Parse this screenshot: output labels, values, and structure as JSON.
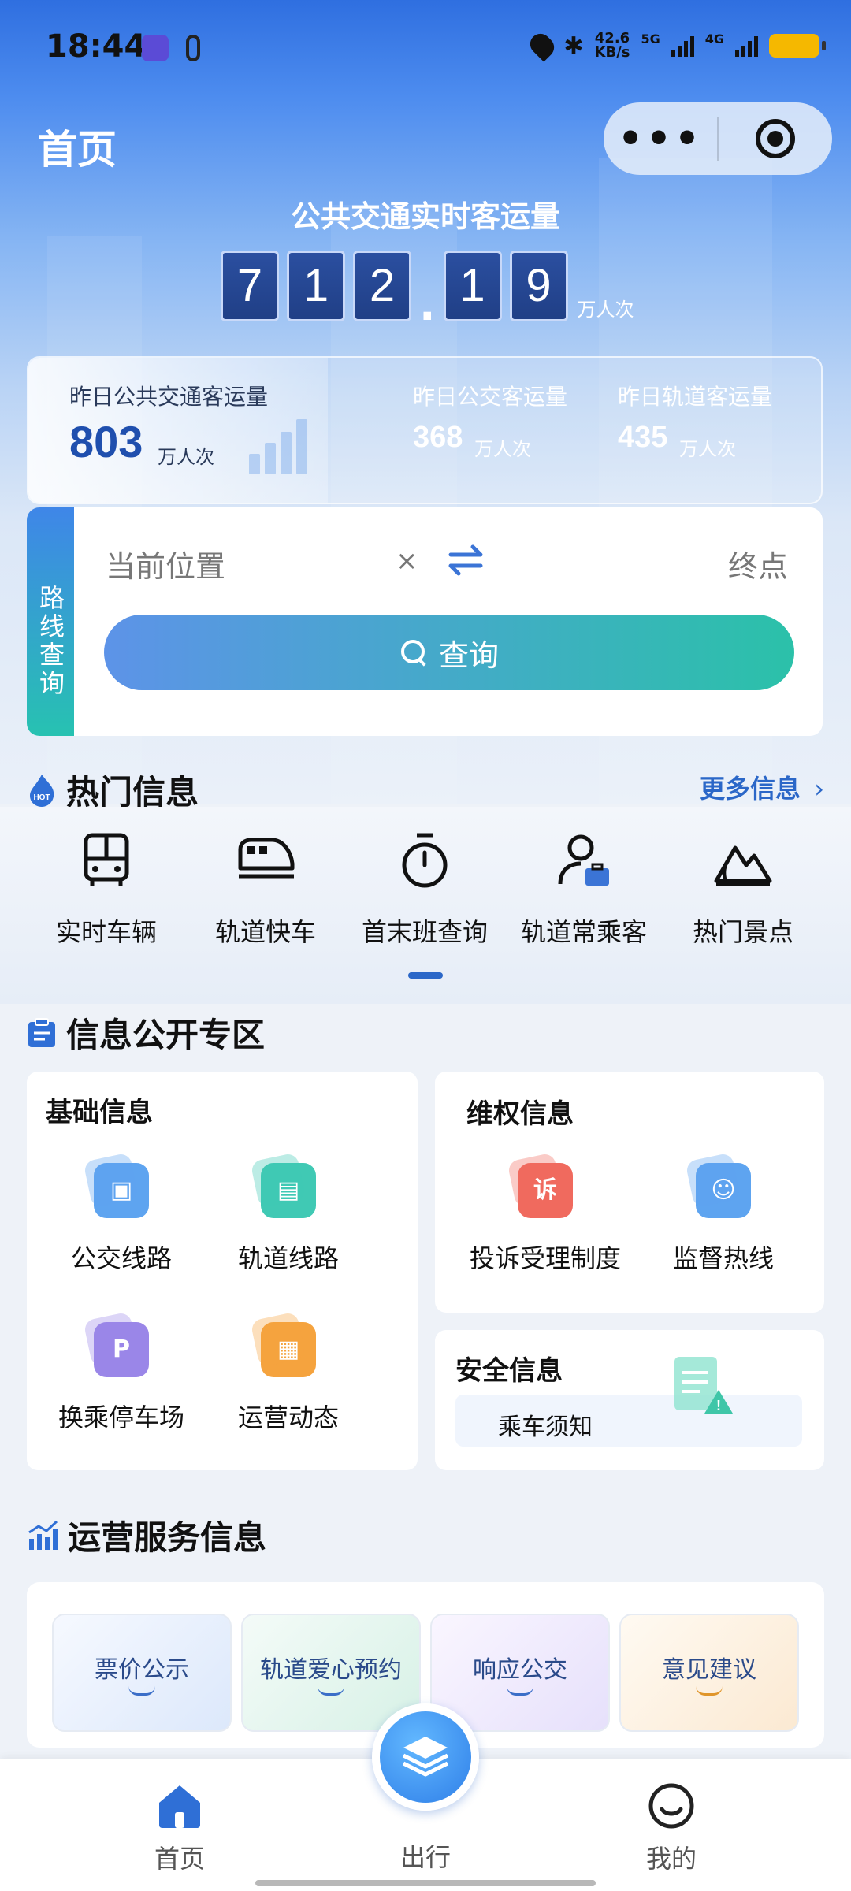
{
  "status_bar": {
    "time": "18:44",
    "net_speed": "42.6",
    "net_unit": "KB/s",
    "net1": "5G",
    "net2": "4G"
  },
  "header": {
    "title": "首页"
  },
  "realtime": {
    "title": "公共交通实时客运量",
    "digits": [
      "7",
      "1",
      "2",
      "1",
      "9"
    ],
    "separator": ".",
    "unit": "万人次"
  },
  "yesterday": {
    "total_label": "昨日公共交通客运量",
    "total_value": "803",
    "bus_label": "昨日公交客运量",
    "bus_value": "368",
    "rail_label": "昨日轨道客运量",
    "rail_value": "435",
    "unit": "万人次"
  },
  "route_query": {
    "tab_label": "路线查询",
    "from_placeholder": "当前位置",
    "clear": "×",
    "to_placeholder": "终点",
    "query_label": "查询"
  },
  "hot": {
    "title": "热门信息",
    "more": "更多信息",
    "more_arrow": "›",
    "items": [
      {
        "label": "实时车辆",
        "icon": "bus-icon"
      },
      {
        "label": "轨道快车",
        "icon": "train-icon"
      },
      {
        "label": "首末班查询",
        "icon": "stopwatch-icon"
      },
      {
        "label": "轨道常乘客",
        "icon": "commuter-icon"
      },
      {
        "label": "热门景点",
        "icon": "mountain-icon"
      }
    ]
  },
  "disclosure": {
    "title": "信息公开专区",
    "basic": {
      "title": "基础信息",
      "items": [
        {
          "label": "公交线路",
          "icon": "bus-route-icon",
          "color": "#5ea4f0"
        },
        {
          "label": "轨道线路",
          "icon": "rail-route-icon",
          "color": "#40c9b4"
        },
        {
          "label": "换乘停车场",
          "icon": "park-ride-icon",
          "color": "#9a86e8"
        },
        {
          "label": "运营动态",
          "icon": "news-icon",
          "color": "#f5a33e"
        }
      ]
    },
    "rights": {
      "title": "维权信息",
      "items": [
        {
          "label": "投诉受理制度",
          "icon": "complaint-icon",
          "glyph": "诉",
          "color": "#f06a5e"
        },
        {
          "label": "监督热线",
          "icon": "hotline-icon",
          "color": "#5ea4f0"
        }
      ]
    },
    "safety": {
      "title": "安全信息",
      "item": "乘车须知"
    }
  },
  "service": {
    "title": "运营服务信息",
    "items": [
      {
        "label": "票价公示"
      },
      {
        "label": "轨道爱心预约"
      },
      {
        "label": "响应公交"
      },
      {
        "label": "意见建议"
      }
    ]
  },
  "tabbar": {
    "home": "首页",
    "travel": "出行",
    "mine": "我的"
  },
  "colors": {
    "accent": "#2b67c8",
    "query_start": "#5d93e8",
    "query_end": "#2bc1a9"
  }
}
